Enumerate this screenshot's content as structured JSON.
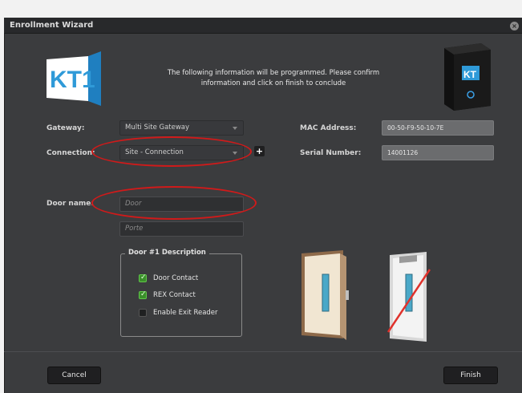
{
  "window": {
    "title": "Enrollment Wizard",
    "close_symbol": "×"
  },
  "logo": {
    "text": "KT1",
    "colors": {
      "blue": "#2f9ad8",
      "white": "#ffffff"
    }
  },
  "intro_text": "The following information will be programmed. Please confirm information and click on finish to conclude",
  "form": {
    "gateway": {
      "label": "Gateway:",
      "value": "Multi Site Gateway"
    },
    "connection": {
      "label": "Connection:",
      "value": "Site - Connection",
      "add_symbol": "+"
    },
    "mac": {
      "label": "MAC Address:",
      "value": "00-50-F9-50-10-7E"
    },
    "serial": {
      "label": "Serial Number:",
      "value": "14001126"
    },
    "door_name": {
      "label": "Door name:",
      "placeholder_primary": "Door",
      "placeholder_secondary": "Porte"
    }
  },
  "door_description": {
    "title": "Door #1 Description",
    "options": [
      {
        "label": "Door Contact",
        "checked": true
      },
      {
        "label": "REX Contact",
        "checked": true
      },
      {
        "label": "Enable Exit Reader",
        "checked": false
      }
    ]
  },
  "footer": {
    "cancel_label": "Cancel",
    "finish_label": "Finish"
  },
  "colors": {
    "annotation_red": "#d01a1a",
    "check_green": "#3a8f2a"
  }
}
